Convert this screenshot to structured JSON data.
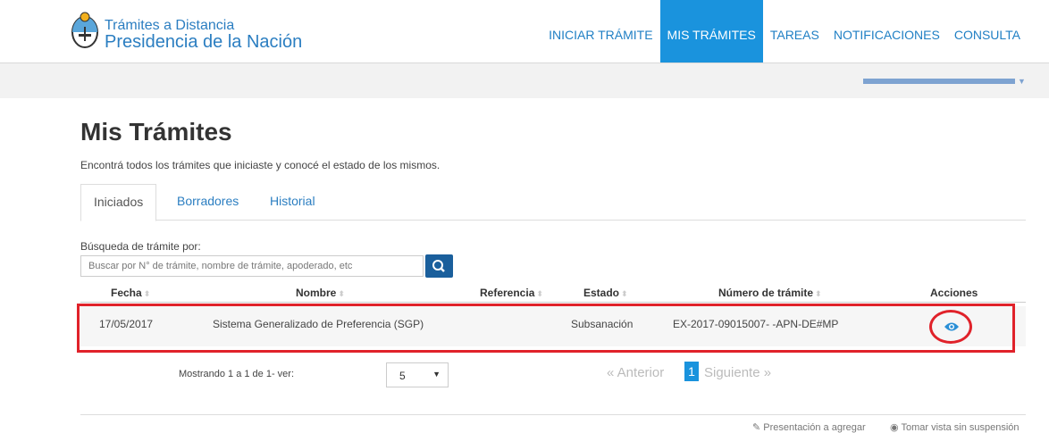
{
  "brand": {
    "line1": "Trámites a Distancia",
    "line2": "Presidencia de la Nación",
    "color": "#2b7ec1"
  },
  "nav": {
    "items": [
      {
        "label": "INICIAR TRÁMITE",
        "active": false
      },
      {
        "label": "MIS TRÁMITES",
        "active": true
      },
      {
        "label": "TAREAS",
        "active": false
      },
      {
        "label": "NOTIFICACIONES",
        "active": false
      },
      {
        "label": "CONSULTA",
        "active": false
      }
    ],
    "active_color": "#1a93dd"
  },
  "page": {
    "title": "Mis Trámites",
    "subtitle": "Encontrá todos los trámites que iniciaste y conocé el estado de los mismos."
  },
  "tabs": [
    {
      "label": "Iniciados",
      "active": true
    },
    {
      "label": "Borradores",
      "active": false
    },
    {
      "label": "Historial",
      "active": false
    }
  ],
  "search": {
    "label": "Búsqueda de trámite por:",
    "placeholder": "Buscar por N° de trámite, nombre de trámite, apoderado, etc",
    "value": "",
    "icon": "search-icon"
  },
  "table": {
    "columns": [
      "Fecha",
      "Nombre",
      "Referencia",
      "Estado",
      "Número de trámite",
      "Acciones"
    ],
    "rows": [
      {
        "fecha": "17/05/2017",
        "nombre": "Sistema Generalizado de Preferencia (SGP)",
        "referencia": "",
        "estado": "Subsanación",
        "numero": "EX-2017-09015007- -APN-DE#MP",
        "accion_icon": "eye-icon"
      }
    ],
    "highlight_color": "#e0222a"
  },
  "pagination": {
    "showing": "Mostrando 1 a 1 de 1- ver:",
    "page_size": "5",
    "prev": "« Anterior",
    "current": "1",
    "next": "Siguiente »"
  },
  "footer": {
    "link1": "Presentación a agregar",
    "link1_icon": "edit-icon",
    "link2": "Tomar vista sin suspensión",
    "link2_icon": "eye-icon"
  }
}
